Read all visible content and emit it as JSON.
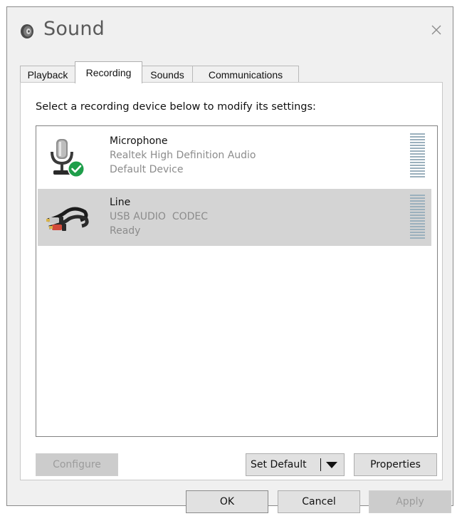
{
  "window": {
    "title": "Sound",
    "icon": "speaker-icon"
  },
  "tabs": [
    {
      "label": "Playback",
      "active": false
    },
    {
      "label": "Recording",
      "active": true
    },
    {
      "label": "Sounds",
      "active": false
    },
    {
      "label": "Communications",
      "active": false
    }
  ],
  "panel": {
    "instruction": "Select a recording device below to modify its settings:",
    "devices": [
      {
        "name": "Microphone",
        "driver": "Realtek High Definition Audio",
        "status": "Default Device",
        "icon": "microphone-icon",
        "badge": "default-check-icon",
        "selected": false
      },
      {
        "name": "Line",
        "driver": "USB AUDIO  CODEC",
        "status": "Ready",
        "icon": "rca-cable-icon",
        "selected": true
      }
    ],
    "buttons": {
      "configure": "Configure",
      "set_default": "Set Default",
      "properties": "Properties"
    }
  },
  "footer": {
    "ok": "OK",
    "cancel": "Cancel",
    "apply": "Apply"
  },
  "colors": {
    "selected_row": "#d4d4d4",
    "check_badge": "#1e9e4a",
    "level_meter": "#9bb0bd"
  }
}
